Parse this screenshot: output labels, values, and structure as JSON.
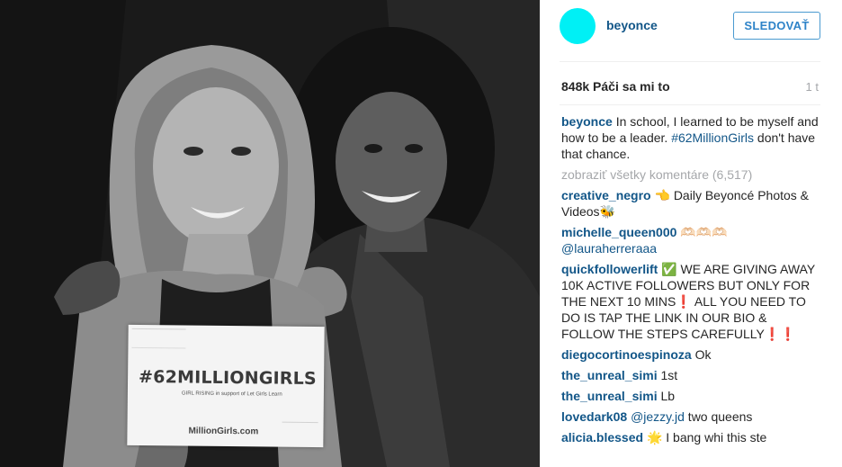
{
  "post": {
    "sign": {
      "title": "#62MILLIONGIRLS",
      "subtitle": "GIRL RISING  in support of Let Girls Learn",
      "url": "MillionGirls.com"
    }
  },
  "header": {
    "avatar_color": "#00f0f5",
    "username": "beyonce",
    "follow_label": "SLEDOVAŤ"
  },
  "stats": {
    "likes": "848k Páči sa mi to",
    "time": "1 t"
  },
  "caption": {
    "user": "beyonce",
    "text_before": " In school, I learned to be myself and how to be a leader. ",
    "hashtag": "#62MillionGirls",
    "text_after": " don't have that chance."
  },
  "view_all": "zobraziť všetky komentáre (6,517)",
  "comments": [
    {
      "user": "creative_negro",
      "mention": "",
      "text": " 👈 Daily Beyoncé Photos & Videos🐝"
    },
    {
      "user": "michelle_queen000",
      "mention": "@lauraherreraaa",
      "text": " 🫶🏻🫶🏻🫶🏻 "
    },
    {
      "user": "quickfollowerlift",
      "mention": "",
      "text": " ✅ WE ARE GIVING AWAY 10K ACTIVE FOLLOWERS BUT ONLY FOR THE NEXT 10 MINS❗ ALL YOU NEED TO DO IS TAP THE LINK IN OUR BIO & FOLLOW THE STEPS CAREFULLY❗❗"
    },
    {
      "user": "diegocortinoespinoza",
      "mention": "",
      "text": " Ok"
    },
    {
      "user": "the_unreal_simi",
      "mention": "",
      "text": " 1st"
    },
    {
      "user": "the_unreal_simi",
      "mention": "",
      "text": " Lb"
    },
    {
      "user": "lovedark08",
      "mention": "@jezzy.jd",
      "text": " two queens"
    },
    {
      "user": "alicia.blessed",
      "mention": "",
      "text": " 🌟 I bang whi this ste"
    }
  ]
}
